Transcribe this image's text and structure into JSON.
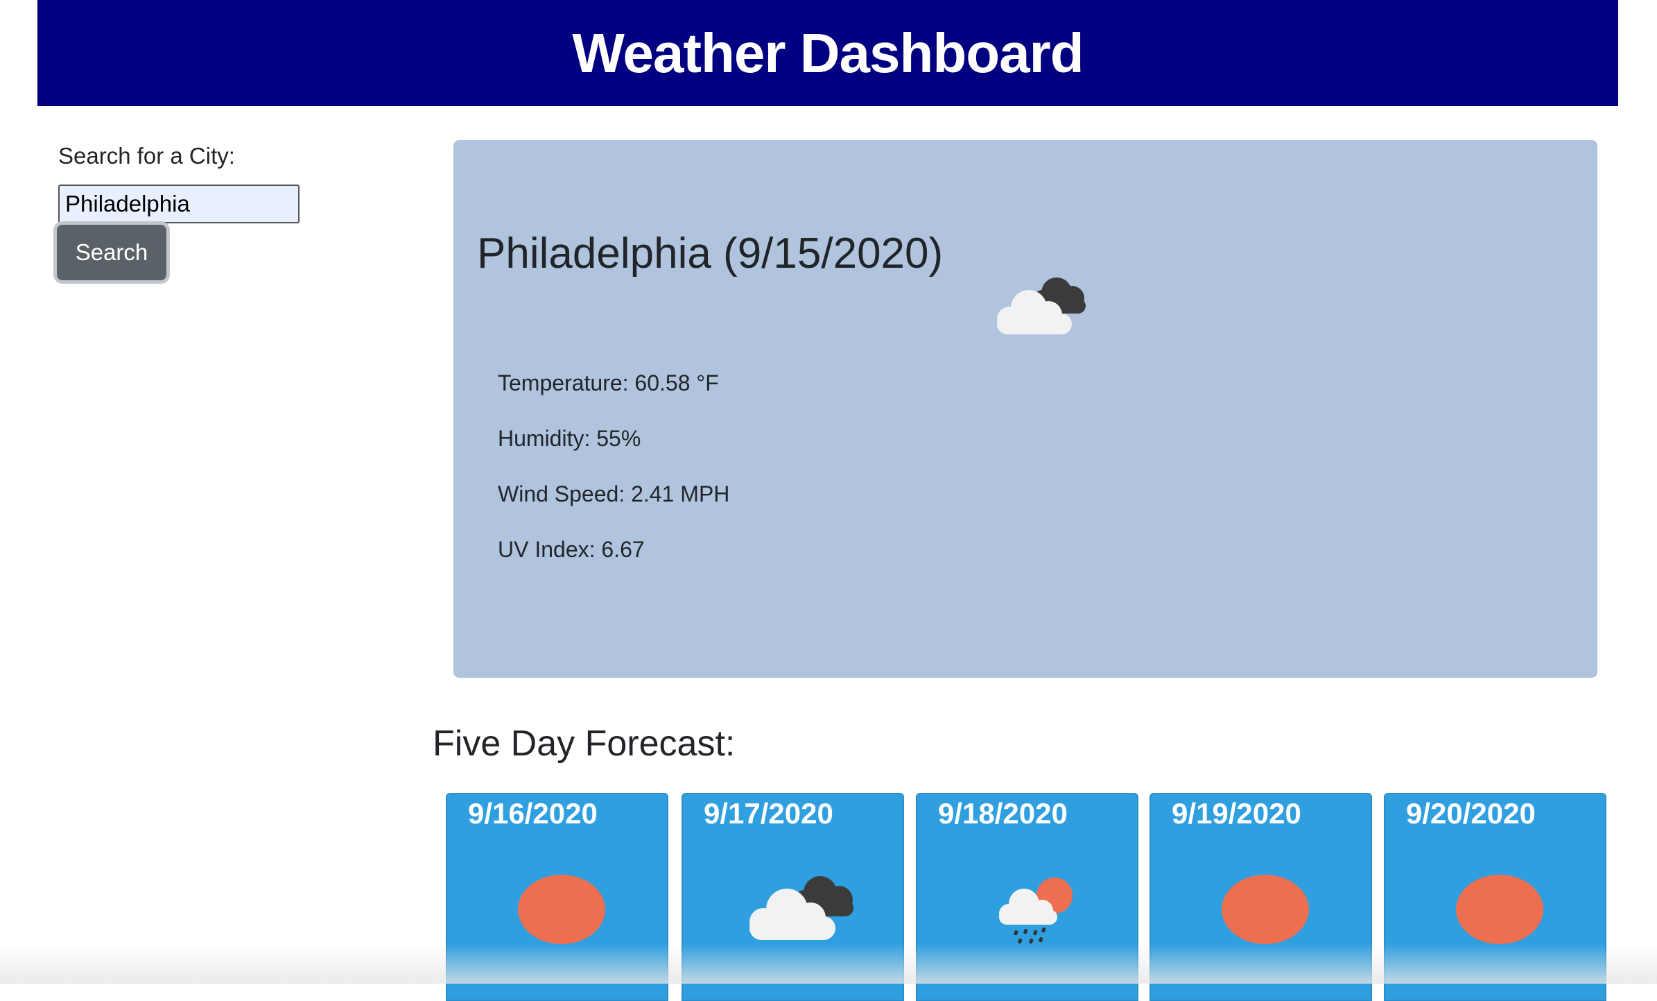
{
  "header": {
    "title": "Weather Dashboard"
  },
  "search": {
    "label": "Search for a City:",
    "value": "Philadelphia",
    "button_label": "Search"
  },
  "current": {
    "heading": "Philadelphia (9/15/2020)",
    "icon": "cloudy-icon",
    "temperature": "Temperature: 60.58 °F",
    "humidity": "Humidity: 55%",
    "wind": "Wind Speed: 2.41 MPH",
    "uv": "UV Index: 6.67"
  },
  "forecast": {
    "title": "Five Day Forecast:",
    "days": [
      {
        "date": "9/16/2020",
        "icon": "sun-icon"
      },
      {
        "date": "9/17/2020",
        "icon": "cloudy-icon"
      },
      {
        "date": "9/18/2020",
        "icon": "rain-icon"
      },
      {
        "date": "9/19/2020",
        "icon": "sun-icon"
      },
      {
        "date": "9/20/2020",
        "icon": "sun-icon"
      }
    ]
  },
  "colors": {
    "header_bg": "#000080",
    "current_card_bg": "#b0c4de",
    "forecast_card_bg": "#2f9fdf",
    "button_bg": "#5a6268",
    "sun": "#ee6e50"
  }
}
